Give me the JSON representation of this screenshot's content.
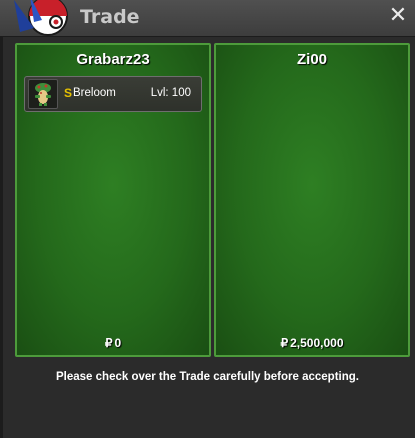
{
  "window": {
    "title": "Trade",
    "close_label": "✕"
  },
  "left_panel": {
    "player_name": "Grabarz23",
    "items": [
      {
        "shiny_badge": "S",
        "name": "Breloom",
        "level": "Lvl: 100"
      }
    ],
    "money_symbol": "₽",
    "money": "0"
  },
  "right_panel": {
    "player_name": "Zi00",
    "money_symbol": "₽",
    "money": "2,500,000"
  },
  "footer": {
    "message": "Please check over the Trade carefully before accepting."
  },
  "colors": {
    "panel_green": "#24691b",
    "panel_border": "#4d9b3b",
    "shiny_gold": "#e5c100",
    "titlebar": "#454545"
  },
  "icons": [
    "pokeball-logo-icon",
    "close-icon",
    "breloom-sprite-icon"
  ]
}
